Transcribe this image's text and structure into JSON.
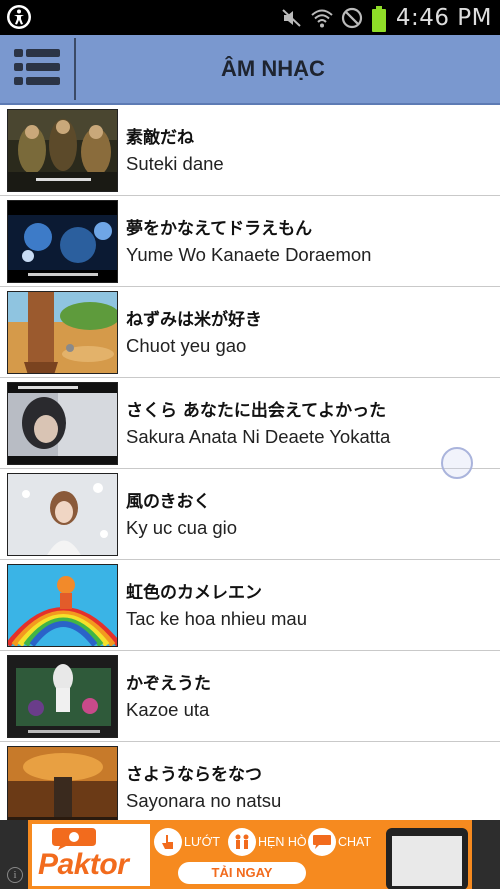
{
  "status_bar": {
    "time": "4:46 PM",
    "icons": [
      "accessibility-icon",
      "mute-icon",
      "wifi-icon",
      "blocked-icon",
      "battery-icon"
    ],
    "battery_color": "#8fdd28"
  },
  "header": {
    "title": "ÂM NHẠC",
    "background": "#7a98cf",
    "menu_icon": "list-menu-icon"
  },
  "songs": [
    {
      "title": "素敵だね",
      "subtitle": "Suteki dane"
    },
    {
      "title": "夢をかなえてドラえもん",
      "subtitle": "Yume Wo Kanaete Doraemon"
    },
    {
      "title": "ねずみは米が好き",
      "subtitle": "Chuot yeu gao"
    },
    {
      "title": "さくら あなたに出会えてよかった",
      "subtitle": "Sakura Anata Ni Deaete Yokatta"
    },
    {
      "title": "風のきおく",
      "subtitle": "Ky uc cua gio"
    },
    {
      "title": "虹色のカメレエン",
      "subtitle": "Tac ke hoa nhieu mau"
    },
    {
      "title": "かぞえうた",
      "subtitle": "Kazoe uta"
    },
    {
      "title": "さようならをなつ",
      "subtitle": "Sayonara no natsu"
    }
  ],
  "ad": {
    "logo": "Paktor",
    "features": [
      "LƯỚT",
      "HẸN HÒ",
      "CHAT"
    ],
    "cta": "TẢI NGAY",
    "accent": "#f68a1f"
  }
}
